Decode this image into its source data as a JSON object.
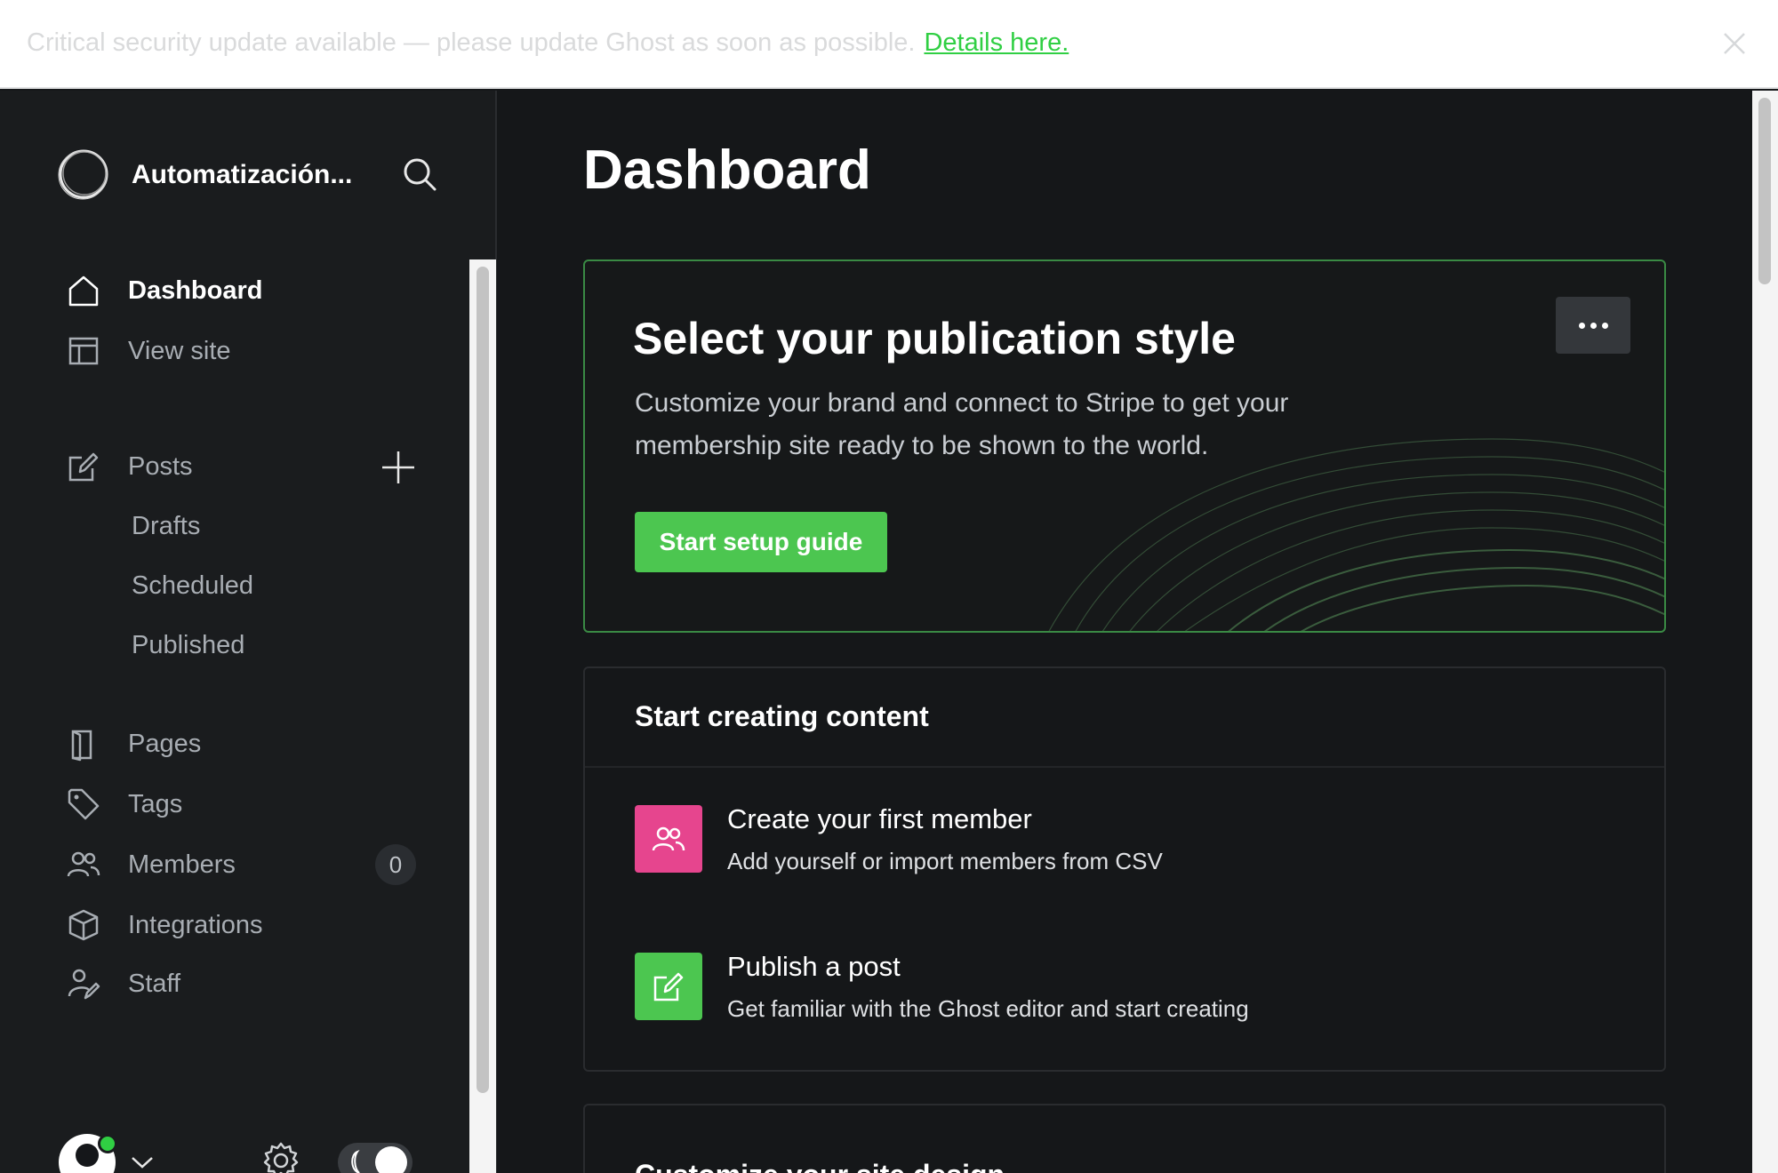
{
  "banner": {
    "message": "Critical security update available — please update Ghost as soon as possible.",
    "link_text": "Details here."
  },
  "sidebar": {
    "site_title": "Automatización...",
    "items": [
      {
        "label": "Dashboard",
        "icon": "home-icon",
        "active": true
      },
      {
        "label": "View site",
        "icon": "layout-icon"
      },
      {
        "label": "Posts",
        "icon": "edit-icon"
      },
      {
        "label": "Pages",
        "icon": "page-icon"
      },
      {
        "label": "Tags",
        "icon": "tag-icon"
      },
      {
        "label": "Members",
        "icon": "members-icon"
      },
      {
        "label": "Integrations",
        "icon": "box-icon"
      },
      {
        "label": "Staff",
        "icon": "staff-icon"
      }
    ],
    "post_subitems": [
      "Drafts",
      "Scheduled",
      "Published"
    ],
    "members_count": "0"
  },
  "main": {
    "title": "Dashboard",
    "publication_card": {
      "title": "Select your publication style",
      "description": "Customize your brand and connect to Stripe to get your membership site ready to be shown to the world.",
      "button": "Start setup guide"
    },
    "content_card": {
      "title": "Start creating content",
      "tasks": [
        {
          "title": "Create your first member",
          "description": "Add yourself or import members from CSV",
          "icon": "members-icon",
          "color": "#e6458e"
        },
        {
          "title": "Publish a post",
          "description": "Get familiar with the Ghost editor and start creating",
          "icon": "edit-icon",
          "color": "#4cc650"
        }
      ]
    },
    "design_card": {
      "title": "Customize your site design"
    }
  },
  "colors": {
    "accent": "#30cf43",
    "sidebar_bg": "#1a1c1e",
    "main_bg": "#151719"
  }
}
